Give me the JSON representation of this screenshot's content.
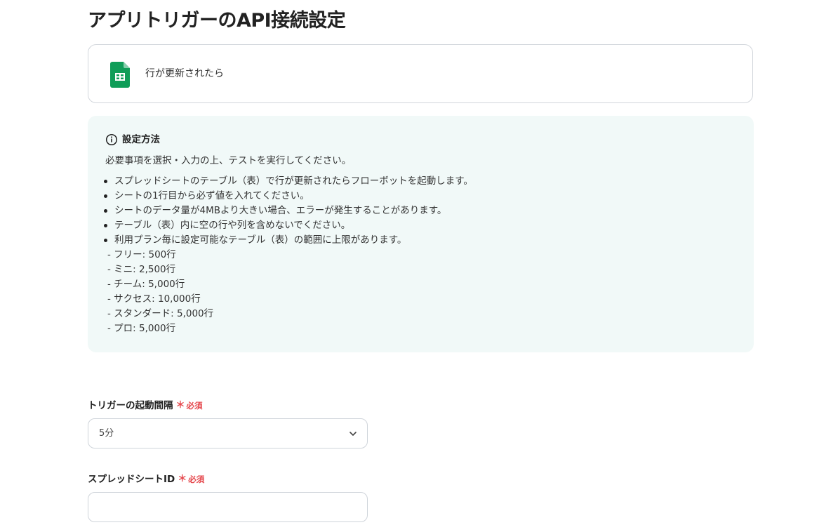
{
  "page": {
    "title": "アプリトリガーのAPI接続設定"
  },
  "trigger": {
    "icon": "google-sheets-icon",
    "label": "行が更新されたら"
  },
  "info": {
    "icon": "info-circle-icon",
    "title": "設定方法",
    "description": "必要事項を選択・入力の上、テストを実行してください。",
    "bullets": [
      "スプレッドシートのテーブル（表）で行が更新されたらフローボットを起動します。",
      "シートの1行目から必ず値を入れてください。",
      "シートのデータ量が4MBより大きい場合、エラーが発生することがあります。",
      "テーブル（表）内に空の行や列を含めないでください。",
      "利用プラン毎に設定可能なテーブル（表）の範囲に上限があります。"
    ],
    "plans": [
      "- フリー: 500行",
      "- ミニ: 2,500行",
      "- チーム: 5,000行",
      "- サクセス: 10,000行",
      "- スタンダード: 5,000行",
      "- プロ: 5,000行"
    ]
  },
  "fields": {
    "interval": {
      "label": "トリガーの起動間隔",
      "required_mark": "＊",
      "required_text": "必須",
      "value": "5分"
    },
    "spreadsheet_id": {
      "label": "スプレッドシートID",
      "required_mark": "＊",
      "required_text": "必須",
      "value": "",
      "placeholder": ""
    }
  },
  "colors": {
    "required": "#e5484d",
    "info_bg": "#f1f9f8",
    "sheets_green": "#0f9d58"
  }
}
